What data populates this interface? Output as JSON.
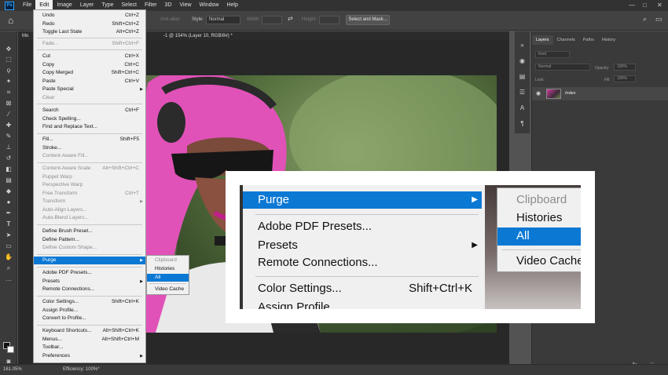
{
  "menubar": {
    "logo": "Ps",
    "items": [
      "File",
      "Edit",
      "Image",
      "Layer",
      "Type",
      "Select",
      "Filter",
      "3D",
      "View",
      "Window",
      "Help"
    ],
    "active": "Edit"
  },
  "options": {
    "anti_alias": "Anti-alias",
    "style_label": "Style:",
    "style_value": "Normal",
    "width_label": "Width:",
    "height_label": "Height:",
    "select_mask": "Select and Mask..."
  },
  "document": {
    "tab_prefix": "Mo",
    "tab_title": "-1 @ 154% (Layer 10, RGB/8#) *",
    "tab_close": "×"
  },
  "status": {
    "zoom": "161.05%",
    "efficiency": "Efficiency: 100%*"
  },
  "layers_panel": {
    "tabs": [
      "Layers",
      "Channels",
      "Paths",
      "History"
    ],
    "kind": "Kind",
    "blend": "Normal",
    "opacity_label": "Opacity:",
    "opacity": "100%",
    "lock_label": "Lock:",
    "fill_label": "Fill:",
    "fill": "100%",
    "layer_name": "Index",
    "footer_icons": [
      "fx",
      "□"
    ]
  },
  "edit_menu": {
    "items": [
      {
        "label": "Undo",
        "shortcut": "Ctrl+Z"
      },
      {
        "label": "Redo",
        "shortcut": "Shift+Ctrl+Z"
      },
      {
        "label": "Toggle Last State",
        "shortcut": "Alt+Ctrl+Z"
      },
      {
        "label": "Fade...",
        "shortcut": "Shift+Ctrl+F"
      },
      {
        "label": "Cut",
        "shortcut": "Ctrl+X"
      },
      {
        "label": "Copy",
        "shortcut": "Ctrl+C"
      },
      {
        "label": "Copy Merged",
        "shortcut": "Shift+Ctrl+C"
      },
      {
        "label": "Paste",
        "shortcut": "Ctrl+V"
      },
      {
        "label": "Paste Special",
        "shortcut": ""
      },
      {
        "label": "Clear",
        "shortcut": ""
      },
      {
        "label": "Search",
        "shortcut": "Ctrl+F"
      },
      {
        "label": "Check Spelling...",
        "shortcut": ""
      },
      {
        "label": "Find and Replace Text...",
        "shortcut": ""
      },
      {
        "label": "Fill...",
        "shortcut": "Shift+F5"
      },
      {
        "label": "Stroke...",
        "shortcut": ""
      },
      {
        "label": "Content-Aware Fill...",
        "shortcut": ""
      },
      {
        "label": "Content-Aware Scale",
        "shortcut": "Alt+Shift+Ctrl+C"
      },
      {
        "label": "Puppet Warp",
        "shortcut": ""
      },
      {
        "label": "Perspective Warp",
        "shortcut": ""
      },
      {
        "label": "Free Transform",
        "shortcut": "Ctrl+T"
      },
      {
        "label": "Transform",
        "shortcut": ""
      },
      {
        "label": "Auto-Align Layers...",
        "shortcut": ""
      },
      {
        "label": "Auto-Blend Layers...",
        "shortcut": ""
      },
      {
        "label": "Define Brush Preset...",
        "shortcut": ""
      },
      {
        "label": "Define Pattern...",
        "shortcut": ""
      },
      {
        "label": "Define Custom Shape...",
        "shortcut": ""
      },
      {
        "label": "Purge",
        "shortcut": ""
      },
      {
        "label": "Adobe PDF Presets...",
        "shortcut": ""
      },
      {
        "label": "Presets",
        "shortcut": ""
      },
      {
        "label": "Remote Connections...",
        "shortcut": ""
      },
      {
        "label": "Color Settings...",
        "shortcut": "Shift+Ctrl+K"
      },
      {
        "label": "Assign Profile...",
        "shortcut": ""
      },
      {
        "label": "Convert to Profile...",
        "shortcut": ""
      },
      {
        "label": "Keyboard Shortcuts...",
        "shortcut": "Alt+Shift+Ctrl+K"
      },
      {
        "label": "Menus...",
        "shortcut": "Alt+Shift+Ctrl+M"
      },
      {
        "label": "Toolbar...",
        "shortcut": ""
      },
      {
        "label": "Preferences",
        "shortcut": ""
      }
    ]
  },
  "purge_submenu": [
    "Clipboard",
    "Histories",
    "All",
    "Video Cache"
  ],
  "zoom": {
    "items": [
      {
        "label": "Purge",
        "shortcut": ""
      },
      {
        "label": "Adobe PDF Presets...",
        "shortcut": ""
      },
      {
        "label": "Presets",
        "shortcut": ""
      },
      {
        "label": "Remote Connections...",
        "shortcut": ""
      },
      {
        "label": "Color Settings...",
        "shortcut": "Shift+Ctrl+K"
      },
      {
        "label": "Assign Profile",
        "shortcut": ""
      }
    ],
    "submenu": [
      "Clipboard",
      "Histories",
      "All",
      "Video Cache"
    ]
  },
  "colors": {
    "accent": "#0b78d4",
    "menu_bg": "#f0f0f0",
    "app_bg": "#535353",
    "hair": "#e052b8"
  }
}
